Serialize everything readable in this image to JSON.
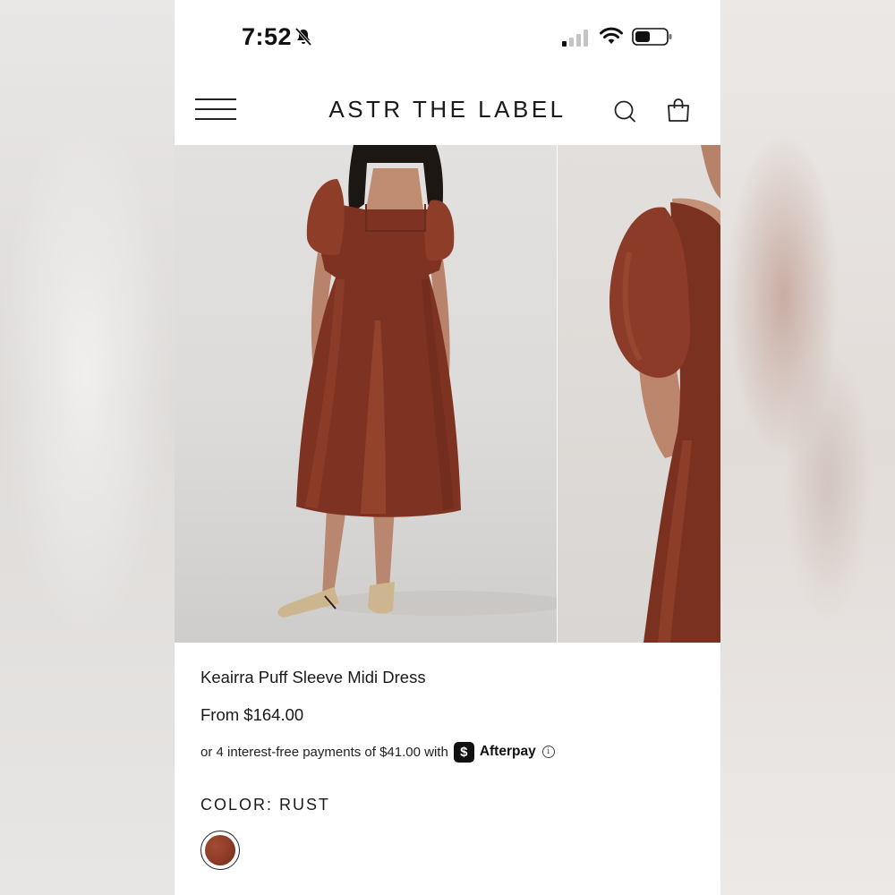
{
  "status_bar": {
    "time": "7:52"
  },
  "header": {
    "brand": "ASTR THE LABEL"
  },
  "icons": {
    "menu": "hamburger-menu-icon",
    "search": "search-icon",
    "cart": "shopping-bag-icon",
    "silent": "bell-slash-icon",
    "signal": "signal-icon",
    "wifi": "wifi-icon",
    "battery": "battery-icon",
    "info": "info-icon"
  },
  "product": {
    "title": "Keairra Puff Sleeve Midi Dress",
    "price": "From $164.00",
    "installments_text": "or 4 interest-free payments of $41.00 with",
    "afterpay_badge": "$",
    "afterpay_label": "Afterpay",
    "info_glyph": "i",
    "color_label": "COLOR:",
    "color_value": "RUST",
    "swatch_color": "#8a3a27"
  },
  "colors": {
    "dress": "#7e3322",
    "dress_highlight": "#a9523a",
    "background": "#ffffff",
    "text": "#1a1a1a"
  }
}
